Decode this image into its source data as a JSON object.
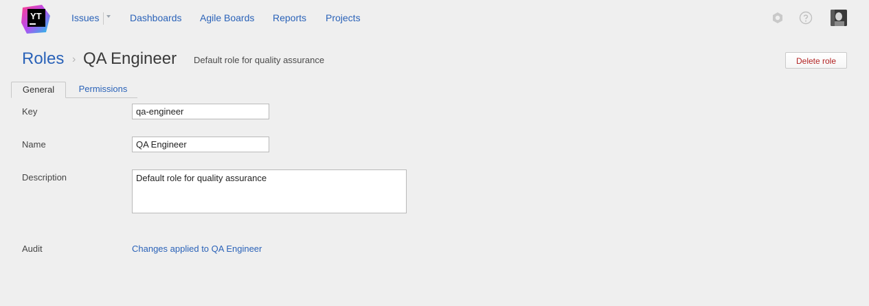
{
  "app": {
    "logo_text": "YT",
    "colors": {
      "link": "#2a62b8",
      "danger": "#b22222",
      "background": "#efefef"
    }
  },
  "nav": {
    "items": [
      {
        "label": "Issues",
        "has_dropdown": true
      },
      {
        "label": "Dashboards"
      },
      {
        "label": "Agile Boards"
      },
      {
        "label": "Reports"
      },
      {
        "label": "Projects"
      }
    ]
  },
  "header_icons": {
    "settings": "gear-icon",
    "help": "help-icon",
    "avatar": "user-avatar"
  },
  "breadcrumb": {
    "parent": "Roles",
    "separator": "›",
    "current": "QA Engineer"
  },
  "page": {
    "description": "Default role for quality assurance",
    "delete_label": "Delete role"
  },
  "tabs": [
    {
      "label": "General",
      "active": true
    },
    {
      "label": "Permissions",
      "active": false
    }
  ],
  "form": {
    "key": {
      "label": "Key",
      "value": "qa-engineer"
    },
    "name": {
      "label": "Name",
      "value": "QA Engineer"
    },
    "description": {
      "label": "Description",
      "value": "Default role for quality assurance"
    },
    "audit": {
      "label": "Audit",
      "link": "Changes applied to QA Engineer"
    }
  }
}
